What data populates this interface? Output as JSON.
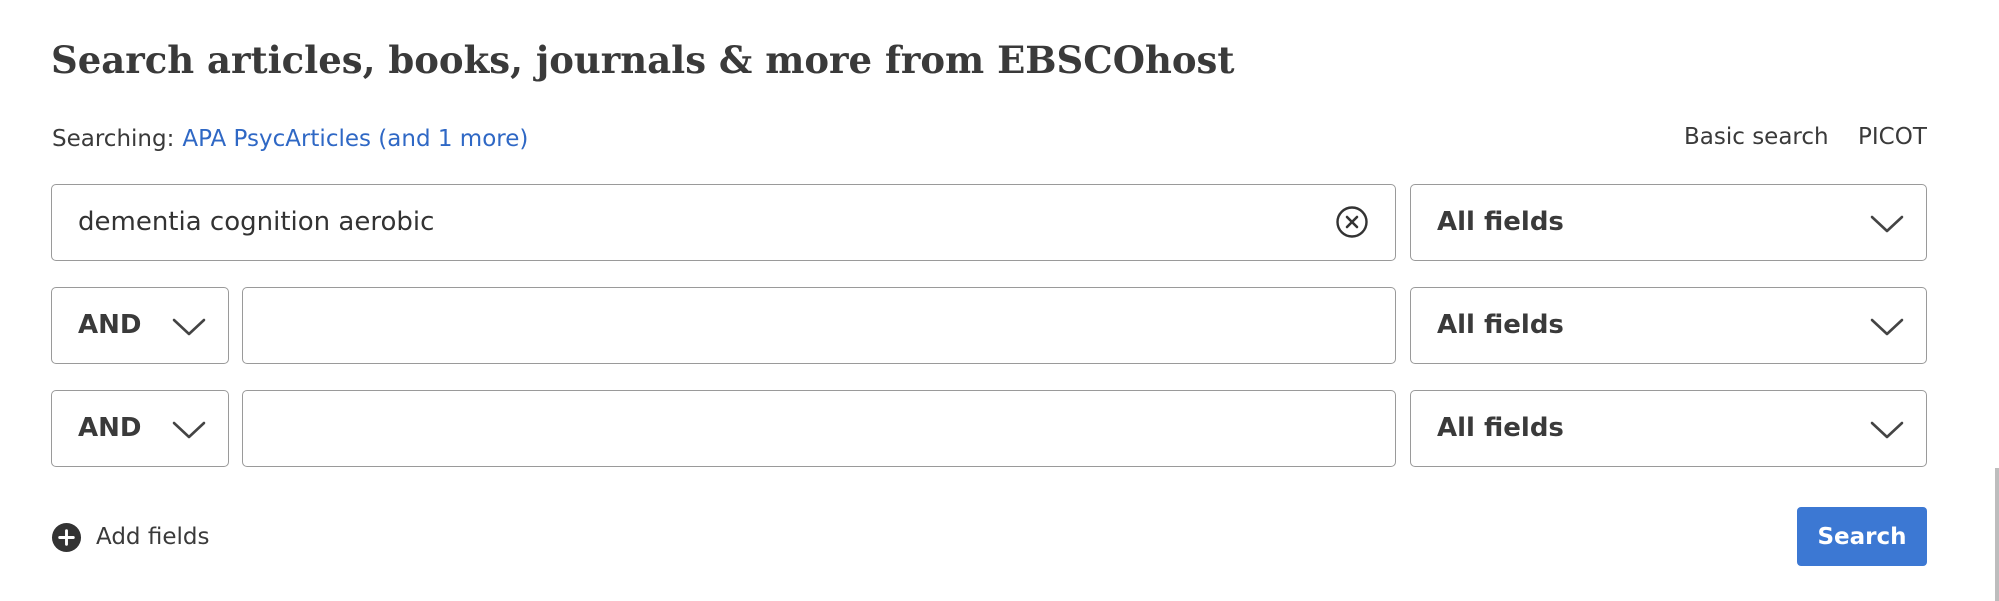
{
  "page": {
    "title": "Search articles, books, journals & more from EBSCOhost"
  },
  "searching": {
    "label": "Searching:",
    "databases_link": "APA PsycArticles (and 1 more)"
  },
  "modes": {
    "basic_label": "Basic search",
    "picot_label": "PICOT"
  },
  "rows": [
    {
      "operator": null,
      "query": "dementia cognition aerobic",
      "field": "All fields"
    },
    {
      "operator": "AND",
      "query": "",
      "field": "All fields"
    },
    {
      "operator": "AND",
      "query": "",
      "field": "All fields"
    }
  ],
  "icons": {
    "clear": "clear-circle-x-icon",
    "dropdown": "chevron-down-icon",
    "add": "plus-circle-icon"
  },
  "actions": {
    "add_fields_label": "Add fields",
    "search_label": "Search"
  },
  "colors": {
    "link": "#2f68c5",
    "primary_button": "#3c78d3",
    "border": "#9a9a9a",
    "text": "#3a3a3a"
  }
}
